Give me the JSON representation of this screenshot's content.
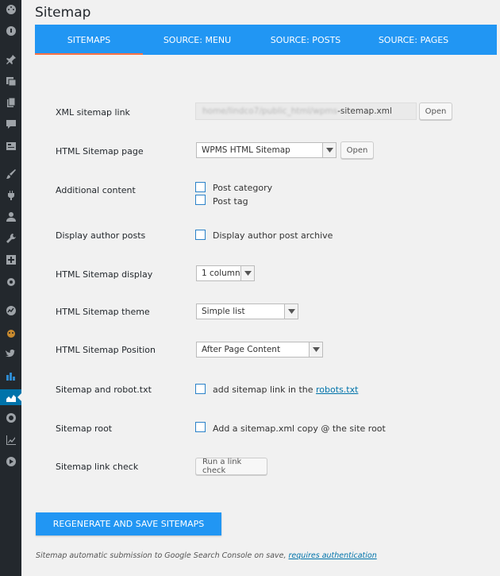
{
  "page": {
    "title": "Sitemap"
  },
  "tabs": [
    {
      "label": "SITEMAPS",
      "active": true
    },
    {
      "label": "SOURCE: MENU"
    },
    {
      "label": "SOURCE: POSTS"
    },
    {
      "label": "SOURCE: PAGES"
    }
  ],
  "sidebar": {
    "icons": [
      "dashboard-icon",
      "gauge-icon",
      "pin-icon",
      "media-icon",
      "pages-icon",
      "comments-icon",
      "layout-icon",
      "brush-icon",
      "plugin-icon",
      "users-icon",
      "tools-icon",
      "plus-box-icon",
      "settings-icon",
      "analytics-icon",
      "mascot-icon",
      "twitter-icon",
      "stats-icon",
      "sitemap-icon",
      "eye-icon",
      "chart-icon",
      "play-icon"
    ],
    "active_index": 17
  },
  "form": {
    "xml_link": {
      "label": "XML sitemap link",
      "value_blurred": "home/lindco7/public_html/wpms",
      "value_suffix": "-sitemap.xml",
      "button": "Open"
    },
    "html_page": {
      "label": "HTML Sitemap page",
      "selected": "WPMS HTML Sitemap",
      "button": "Open"
    },
    "additional_content": {
      "label": "Additional content",
      "options": [
        "Post category",
        "Post tag"
      ]
    },
    "author_posts": {
      "label": "Display author posts",
      "option": "Display author post archive"
    },
    "html_display": {
      "label": "HTML Sitemap display",
      "selected": "1 column"
    },
    "html_theme": {
      "label": "HTML Sitemap theme",
      "selected": "Simple list"
    },
    "html_position": {
      "label": "HTML Sitemap Position",
      "selected": "After Page Content"
    },
    "robots": {
      "label": "Sitemap and robot.txt",
      "option_prefix": "add sitemap link in the ",
      "option_link": "robots.txt"
    },
    "root": {
      "label": "Sitemap root",
      "option": "Add a sitemap.xml copy @ the site root"
    },
    "link_check": {
      "label": "Sitemap link check",
      "button": "Run a link check"
    }
  },
  "actions": {
    "save": "REGENERATE AND SAVE SITEMAPS"
  },
  "footnote": {
    "text": "Sitemap automatic submission to Google Search Console on save, ",
    "link": "requires authentication"
  },
  "colors": {
    "accent": "#2196f3",
    "tab_indicator": "#ff7043",
    "sidebar_bg": "#23282d",
    "sidebar_active": "#0073aa",
    "link": "#0073aa"
  }
}
